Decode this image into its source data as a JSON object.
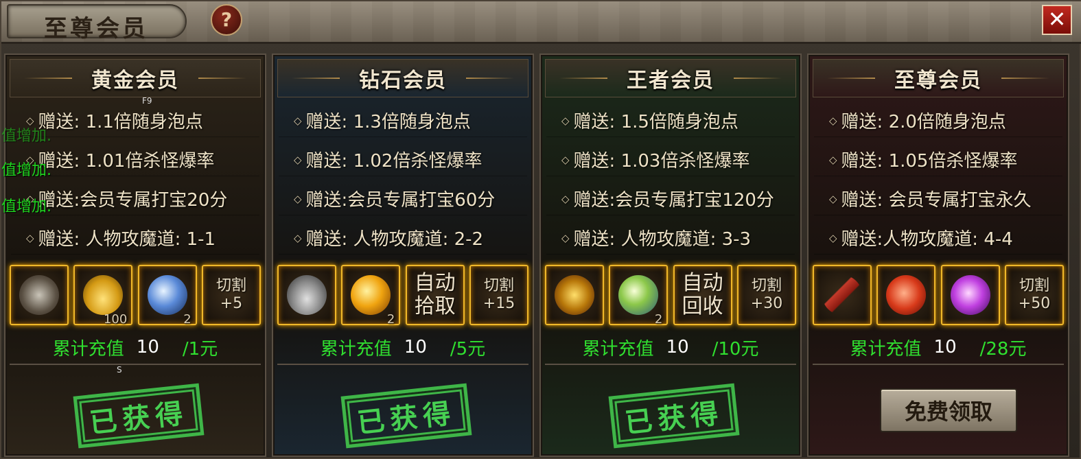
{
  "window": {
    "title": "至尊会员",
    "help_glyph": "?",
    "close_glyph": "✕"
  },
  "tiers": [
    {
      "title": "黄金会员",
      "theme": "#2c2419",
      "benefits": [
        "赠送:   1.1倍随身泡点",
        "赠送:  1.01倍杀怪爆率",
        "赠送:会员专属打宝20分",
        "赠送: 人物攻魔道: 1-1"
      ],
      "items": [
        {
          "icon": "axe-icon"
        },
        {
          "icon": "gold-ingot-icon",
          "count": "100"
        },
        {
          "icon": "blue-orb-icon",
          "count": "2"
        },
        {
          "text": [
            "切割",
            "+5"
          ]
        }
      ],
      "recharge": {
        "label": "累计充值",
        "value": "10",
        "per": "/1元"
      },
      "status": "已获得"
    },
    {
      "title": "钻石会员",
      "theme": "#1a2630",
      "benefits": [
        "赠送:   1.3倍随身泡点",
        "赠送:  1.02倍杀怪爆率",
        "赠送:会员专属打宝60分",
        "赠送: 人物攻魔道: 2-2"
      ],
      "items": [
        {
          "icon": "hat-icon"
        },
        {
          "icon": "golden-orb-icon",
          "count": "2"
        },
        {
          "big": [
            "自动",
            "拾取"
          ]
        },
        {
          "text": [
            "切割",
            "+15"
          ]
        }
      ],
      "recharge": {
        "label": "累计充值",
        "value": "10",
        "per": "/5元"
      },
      "status": "已获得"
    },
    {
      "title": "王者会员",
      "theme": "#1b2a1b",
      "benefits": [
        "赠送:   1.5倍随身泡点",
        "赠送:  1.03倍杀怪爆率",
        "赠送:会员专属打宝120分",
        "赠送: 人物攻魔道: 3-3"
      ],
      "items": [
        {
          "icon": "medal-icon"
        },
        {
          "icon": "green-orb-icon",
          "count": "2"
        },
        {
          "big": [
            "自动",
            "回收"
          ]
        },
        {
          "text": [
            "切割",
            "+30"
          ]
        }
      ],
      "recharge": {
        "label": "累计充值",
        "value": "10",
        "per": "/10元"
      },
      "status": "已获得"
    },
    {
      "title": "至尊会员",
      "theme": "#2e1818",
      "benefits": [
        "赠送:   2.0倍随身泡点",
        "赠送:  1.05倍杀怪爆率",
        "赠送: 会员专属打宝永久",
        "赠送:人物攻魔道: 4-4"
      ],
      "items": [
        {
          "icon": "sword-icon"
        },
        {
          "icon": "soul-orb-icon"
        },
        {
          "icon": "purple-gem-icon"
        },
        {
          "text": [
            "切割",
            "+50"
          ]
        }
      ],
      "recharge": {
        "label": "累计充值",
        "value": "10",
        "per": "/28元"
      },
      "button": "免费领取"
    }
  ],
  "overlays": [
    "值增加.",
    "值增加.",
    "值增加."
  ],
  "debug": {
    "f9": "F9",
    "s": "S"
  }
}
